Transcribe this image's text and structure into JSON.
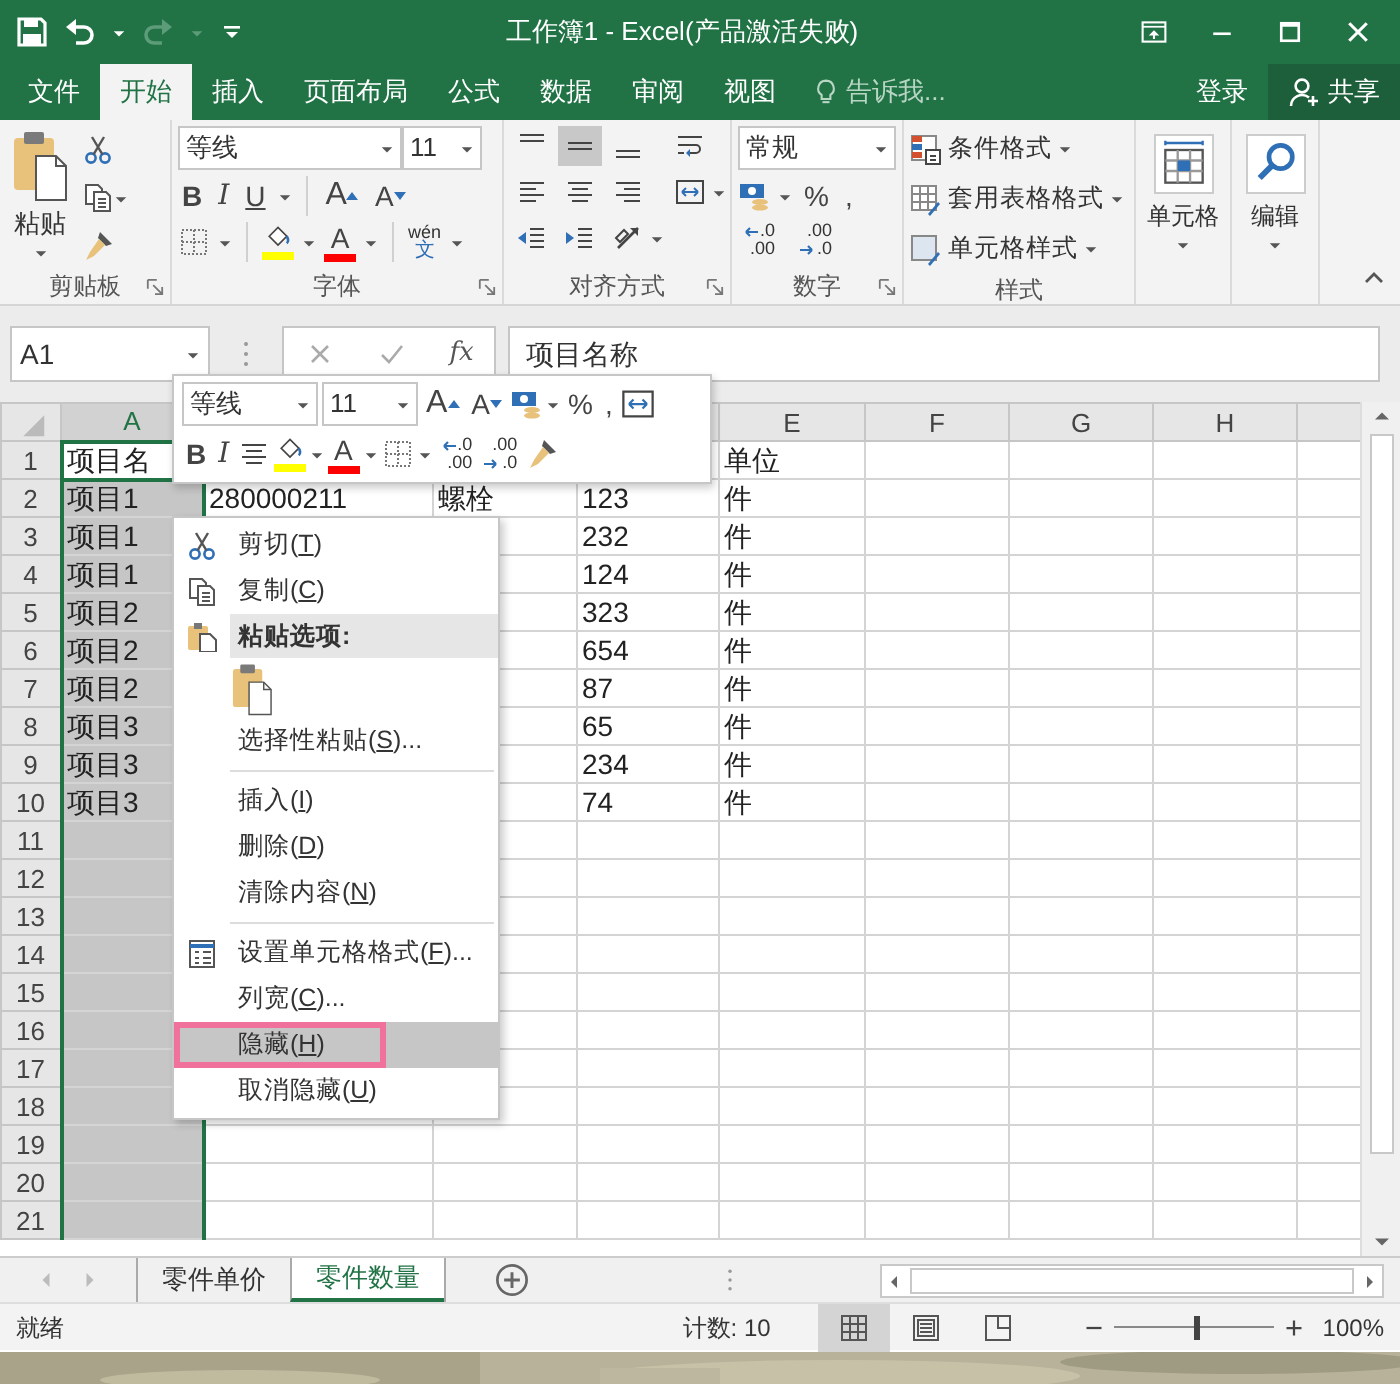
{
  "window": {
    "title": "工作簿1 - Excel(产品激活失败)"
  },
  "ribbon_tabs": [
    {
      "label": "文件",
      "selected": false
    },
    {
      "label": "开始",
      "selected": true
    },
    {
      "label": "插入",
      "selected": false
    },
    {
      "label": "页面布局",
      "selected": false
    },
    {
      "label": "公式",
      "selected": false
    },
    {
      "label": "数据",
      "selected": false
    },
    {
      "label": "审阅",
      "selected": false
    },
    {
      "label": "视图",
      "selected": false
    }
  ],
  "tell_me": {
    "placeholder": "告诉我..."
  },
  "sign_in": "登录",
  "share": "共享",
  "ribbon": {
    "clipboard": {
      "label": "剪贴板",
      "paste": "粘贴"
    },
    "font": {
      "label": "字体",
      "font_name": "等线",
      "font_size": "11",
      "bold": "B",
      "italic": "I",
      "underline": "U",
      "grow": "A",
      "shrink": "A",
      "font_color_letter": "A",
      "phonetic": "wén",
      "phonetic_char": "文"
    },
    "alignment": {
      "label": "对齐方式",
      "buttons": [
        {
          "kind": "top",
          "on": false
        },
        {
          "kind": "middle",
          "on": true
        },
        {
          "kind": "bottom",
          "on": false
        },
        {
          "kind": "wrap",
          "on": false
        },
        {
          "kind": "left",
          "on": false
        },
        {
          "kind": "center",
          "on": false
        },
        {
          "kind": "right",
          "on": false
        },
        {
          "kind": "merge",
          "on": false
        },
        {
          "kind": "outdent",
          "on": false
        },
        {
          "kind": "indent",
          "on": false
        },
        {
          "kind": "orientation",
          "on": false
        }
      ]
    },
    "number": {
      "label": "数字",
      "format": "常规",
      "percent": "%",
      "comma": ",",
      "increase_decimal": {
        "top": ".0",
        "bottom": ".00"
      },
      "decrease_decimal": {
        "top": ".00",
        "bottom": ".0"
      }
    },
    "styles": {
      "label": "样式",
      "commands": [
        "条件格式",
        "套用表格格式",
        "单元格样式"
      ]
    },
    "cells": {
      "label": "单元格"
    },
    "editing": {
      "label": "编辑"
    }
  },
  "formula_bar": {
    "name_box": "A1",
    "fx": "fx",
    "value": "项目名称"
  },
  "mini_toolbar": {
    "font_name": "等线",
    "font_size": "11",
    "grow": "A",
    "shrink": "A",
    "percent": "%",
    "comma": ",",
    "bold": "B",
    "italic": "I",
    "font_color_letter": "A",
    "increase_decimal": {
      "top": ".0",
      "bottom": ".00"
    },
    "decrease_decimal": {
      "top": ".00",
      "bottom": ".0"
    }
  },
  "sheet": {
    "columns": [
      {
        "label": "A",
        "selected": true
      },
      null,
      null,
      null,
      {
        "label": "E",
        "selected": false
      },
      {
        "label": "F",
        "selected": false
      },
      {
        "label": "G",
        "selected": false
      },
      {
        "label": "H",
        "selected": false
      }
    ],
    "rows": [
      {
        "label": "1",
        "active": true,
        "cells": [
          "项目名",
          null,
          null,
          null,
          "单位"
        ]
      },
      {
        "label": "2",
        "active": false,
        "cells": [
          "项目1",
          "280000211",
          "螺栓",
          "123",
          "件"
        ]
      },
      {
        "label": "3",
        "active": false,
        "cells": [
          "项目1",
          null,
          null,
          "232",
          "件"
        ]
      },
      {
        "label": "4",
        "active": false,
        "cells": [
          "项目1",
          null,
          null,
          "124",
          "件"
        ]
      },
      {
        "label": "5",
        "active": false,
        "cells": [
          "项目2",
          null,
          null,
          "323",
          "件"
        ]
      },
      {
        "label": "6",
        "active": false,
        "cells": [
          "项目2",
          null,
          null,
          "654",
          "件"
        ]
      },
      {
        "label": "7",
        "active": false,
        "cells": [
          "项目2",
          null,
          null,
          "87",
          "件"
        ]
      },
      {
        "label": "8",
        "active": false,
        "cells": [
          "项目3",
          null,
          null,
          "65",
          "件"
        ]
      },
      {
        "label": "9",
        "active": false,
        "cells": [
          "项目3",
          null,
          null,
          "234",
          "件"
        ]
      },
      {
        "label": "10",
        "active": false,
        "cells": [
          "项目3",
          null,
          null,
          "74",
          "件"
        ]
      },
      {
        "label": "11",
        "active": false
      },
      {
        "label": "12",
        "active": false
      },
      {
        "label": "13",
        "active": false
      },
      {
        "label": "14",
        "active": false
      },
      {
        "label": "15",
        "active": false
      },
      {
        "label": "16",
        "active": false
      },
      {
        "label": "17",
        "active": false
      },
      {
        "label": "18",
        "active": false
      },
      {
        "label": "19",
        "active": false
      },
      {
        "label": "20",
        "active": false
      },
      {
        "label": "21",
        "active": false
      }
    ]
  },
  "sheet_tabs": [
    {
      "label": "零件单价",
      "selected": false
    },
    {
      "label": "零件数量",
      "selected": true
    }
  ],
  "status_bar": {
    "status": "就绪",
    "count": "计数: 10",
    "views": [
      {
        "kind": "normal",
        "selected": true
      },
      {
        "kind": "page-layout",
        "selected": false
      },
      {
        "kind": "page-break",
        "selected": false
      }
    ],
    "zoom_slider": {
      "level": 0.5
    },
    "zoom": "100%"
  },
  "context_menu": {
    "items": [
      {
        "kind": "command",
        "prefix": "剪切(",
        "key": "T",
        "suffix": ")",
        "selected": false,
        "annotated": false
      },
      {
        "kind": "command",
        "prefix": "复制(",
        "key": "C",
        "suffix": ")",
        "selected": false,
        "annotated": false
      },
      {
        "kind": "heading",
        "text": "粘贴选项:"
      },
      {
        "kind": "paste-options"
      },
      {
        "kind": "command",
        "prefix": "选择性粘贴(",
        "key": "S",
        "suffix": ")...",
        "selected": false,
        "annotated": false
      },
      {
        "kind": "separator"
      },
      {
        "kind": "command",
        "prefix": "插入(",
        "key": "I",
        "suffix": ")",
        "selected": false,
        "annotated": false
      },
      {
        "kind": "command",
        "prefix": "删除(",
        "key": "D",
        "suffix": ")",
        "selected": false,
        "annotated": false
      },
      {
        "kind": "command",
        "prefix": "清除内容(",
        "key": "N",
        "suffix": ")",
        "selected": false,
        "annotated": false
      },
      {
        "kind": "separator"
      },
      {
        "kind": "command",
        "prefix": "设置单元格格式(",
        "key": "F",
        "suffix": ")...",
        "selected": false,
        "annotated": false
      },
      {
        "kind": "command",
        "prefix": "列宽(",
        "key": "C",
        "suffix": ")...",
        "selected": false,
        "annotated": false
      },
      {
        "kind": "command",
        "prefix": "隐藏(",
        "key": "H",
        "suffix": ")",
        "selected": true,
        "annotated": true
      },
      {
        "kind": "command",
        "prefix": "取消隐藏(",
        "key": "U",
        "suffix": ")",
        "selected": false,
        "annotated": false
      }
    ]
  }
}
